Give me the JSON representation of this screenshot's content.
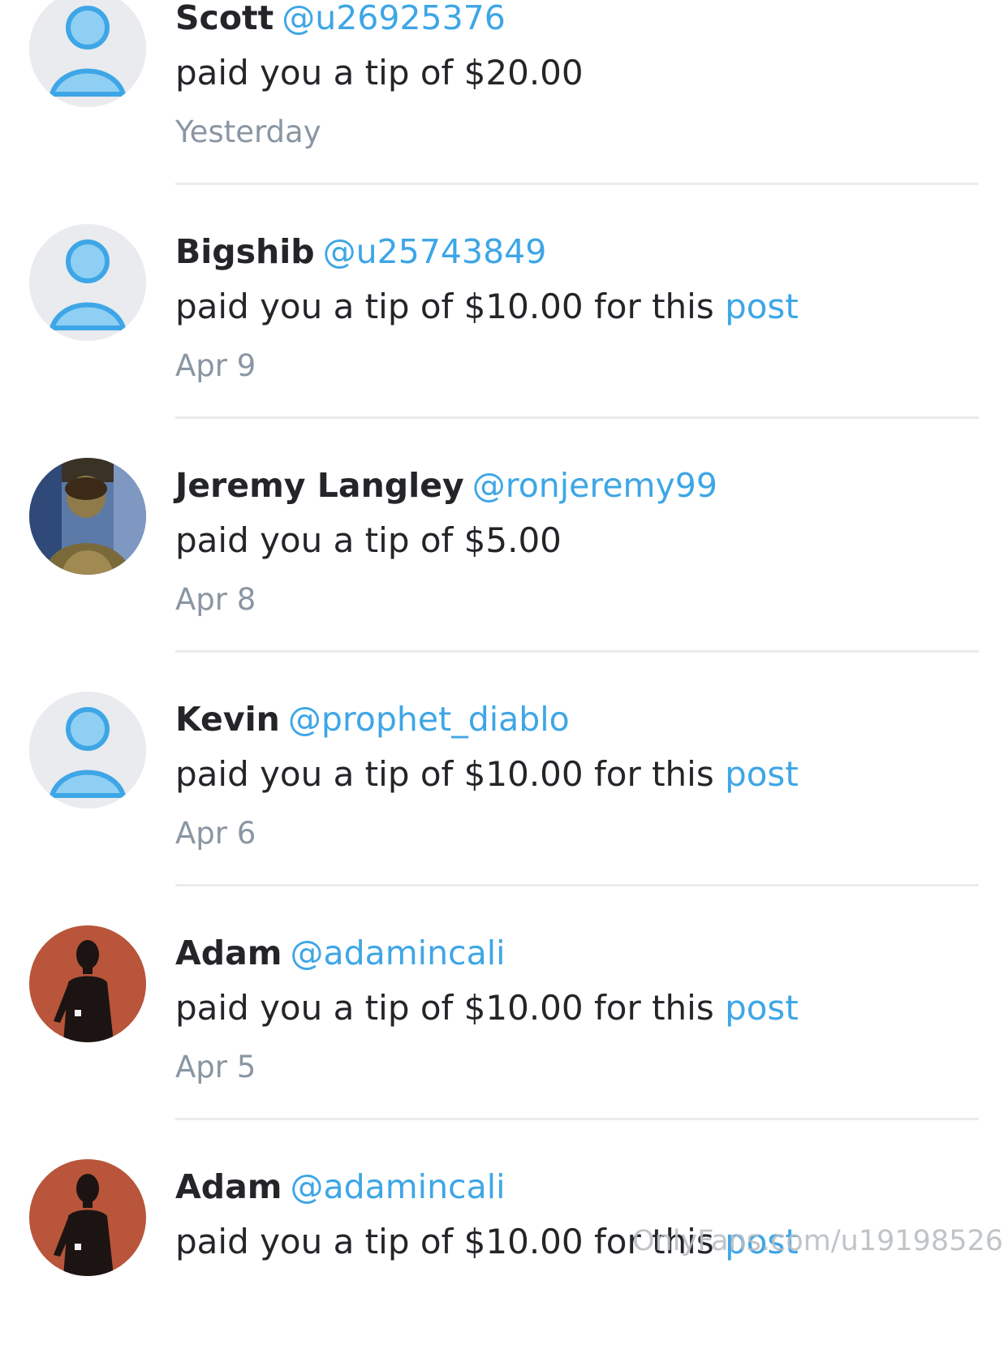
{
  "notifications": [
    {
      "name": "Scott",
      "handle": "@u26925376",
      "message": "paid you a tip of $20.00",
      "link_text": "",
      "time": "Yesterday",
      "avatar": "default-avatar"
    },
    {
      "name": "Bigshib",
      "handle": "@u25743849",
      "message": "paid you a tip of $10.00 for this",
      "link_text": "post",
      "time": "Apr 9",
      "avatar": "default-avatar"
    },
    {
      "name": "Jeremy Langley",
      "handle": "@ronjeremy99",
      "message": "paid you a tip of $5.00",
      "link_text": "",
      "time": "Apr 8",
      "avatar": "photo-avatar-character"
    },
    {
      "name": "Kevin",
      "handle": "@prophet_diablo",
      "message": "paid you a tip of $10.00 for this",
      "link_text": "post",
      "time": "Apr 6",
      "avatar": "default-avatar"
    },
    {
      "name": "Adam",
      "handle": "@adamincali",
      "message": "paid you a tip of $10.00 for this",
      "link_text": "post",
      "time": "Apr 5",
      "avatar": "photo-avatar-silhouette"
    },
    {
      "name": "Adam",
      "handle": "@adamincali",
      "message": "paid you a tip of $10.00 for this",
      "link_text": "post",
      "time": "",
      "avatar": "photo-avatar-silhouette"
    }
  ],
  "watermark": "OnlyFans.com/u19198526",
  "colors": {
    "accent": "#3ea6e6",
    "text": "#242529",
    "muted": "#8a96a3",
    "divider": "#e9ebee"
  }
}
